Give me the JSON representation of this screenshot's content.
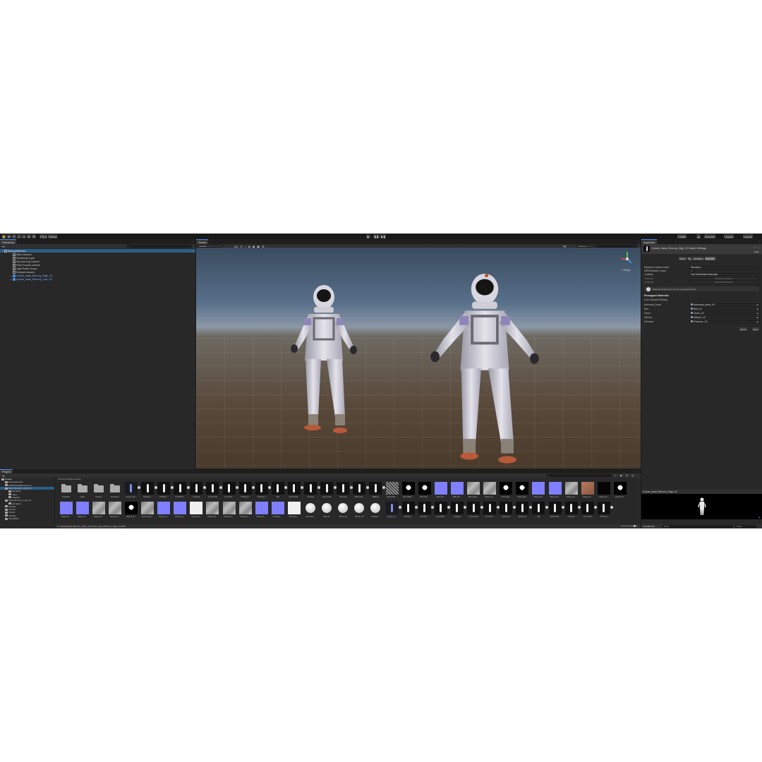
{
  "toolbar": {
    "pivot_label": "Pivot",
    "global_label": "Global",
    "layers_label": "Layers",
    "layout_label": "Layout",
    "account_label": "Account",
    "collab_label": "Collab"
  },
  "hierarchy": {
    "tab_label": "Hierarchy",
    "items": [
      {
        "label": "ExampleScene",
        "depth": 0,
        "kind": "scene"
      },
      {
        "label": "Main Camera",
        "depth": 1,
        "kind": "go"
      },
      {
        "label": "Directional Light",
        "depth": 1,
        "kind": "go"
      },
      {
        "label": "Sky and Fog Volume",
        "depth": 1,
        "kind": "go"
      },
      {
        "label": "Post Process Volume",
        "depth": 1,
        "kind": "go"
      },
      {
        "label": "Light Probe Group",
        "depth": 1,
        "kind": "go"
      },
      {
        "label": "Example Assets",
        "depth": 1,
        "kind": "go"
      },
      {
        "label": "A pose_nasa_Mercury_High_V2",
        "depth": 1,
        "kind": "prefab"
      },
      {
        "label": "A pose_nasa_Mercury_Low_V2",
        "depth": 1,
        "kind": "prefab"
      }
    ]
  },
  "scene": {
    "tab_label": "Scene",
    "shading_mode": "Shaded",
    "gizmos_label": "Gizmos",
    "persp_label": "< Persp"
  },
  "inspector": {
    "tab_label": "Inspector",
    "title": "A pose_nasa_Mercury_High_V2 Import Settings",
    "open_label": "Open",
    "tabs": [
      "Model",
      "Rig",
      "Animation",
      "Materials"
    ],
    "rows": [
      {
        "label": "Material Creation Mode",
        "value": "Standard"
      },
      {
        "label": "sRGB Albedo Colors",
        "value": "✓"
      },
      {
        "label": "Location",
        "value": "Use Embedded Materials"
      },
      {
        "label": "Textures",
        "value": "Extract Textures..."
      },
      {
        "label": "Materials",
        "value": "Extract Materials..."
      }
    ],
    "info_text": "Material assignments can be remapped below.",
    "remap_header": "Remapped Materials",
    "on_demand_label": "On Demand Remap",
    "remaps": [
      {
        "label": "Astronaut_head",
        "value": "Astronaut_head_V2"
      },
      {
        "label": "Bell",
        "value": "Bell_V2"
      },
      {
        "label": "Glove",
        "value": "Glove_V2"
      },
      {
        "label": "Helmet",
        "value": "Helmet_V2"
      },
      {
        "label": "Pressure",
        "value": "Pressure_V2"
      }
    ],
    "revert_label": "Revert",
    "apply_label": "Apply",
    "preview_title": "A pose_nasa_Mercury_High_V2",
    "assetbundle_label": "AssetBundle",
    "assetbundle_value": "None",
    "variant_value": "None"
  },
  "project": {
    "tab_label": "Project",
    "status_text": "Showing Multiple Assets...",
    "tree": [
      {
        "label": "Assets",
        "depth": 0
      },
      {
        "label": "ExampleAssets",
        "depth": 1
      },
      {
        "label": "HDRPDefaultResources",
        "depth": 1
      },
      {
        "label": "Nasa_Mercury_High_V2",
        "depth": 1
      },
      {
        "label": "animation",
        "depth": 2
      },
      {
        "label": "maps",
        "depth": 2
      },
      {
        "label": "material",
        "depth": 2
      },
      {
        "label": "Nasa_Mercury_Low_V2",
        "depth": 1
      },
      {
        "label": "animation",
        "depth": 2
      },
      {
        "label": "Prefabs",
        "depth": 1
      },
      {
        "label": "Scenes",
        "depth": 1
      },
      {
        "label": "Scripts",
        "depth": 1
      },
      {
        "label": "Settings",
        "depth": 1
      },
      {
        "label": "TutorialInfo",
        "depth": 1
      }
    ],
    "path": "Assets/Nasa_Mercury_High_V2/A pose_nasa_Mercury_High_V2.FBX",
    "row1": [
      {
        "label": "animation",
        "kind": "folder"
      },
      {
        "label": "maps",
        "kind": "folder"
      },
      {
        "label": "material",
        "kind": "folder"
      },
      {
        "label": "animation",
        "kind": "folder"
      },
      {
        "label": "A pose_nas...",
        "kind": "model"
      },
      {
        "label": "Climbing...",
        "kind": "anim"
      },
      {
        "label": "Climbing...",
        "kind": "anim"
      },
      {
        "label": "Crawl Bac...",
        "kind": "anim"
      },
      {
        "label": "Crawling",
        "kind": "anim"
      },
      {
        "label": "Crouch Idle",
        "kind": "anim"
      },
      {
        "label": "Crouched...",
        "kind": "anim"
      },
      {
        "label": "Floating_2",
        "kind": "anim"
      },
      {
        "label": "Floating_3",
        "kind": "anim"
      },
      {
        "label": "Idle",
        "kind": "anim"
      },
      {
        "label": "Injured Wa...",
        "kind": "anim"
      },
      {
        "label": "Jumping",
        "kind": "anim"
      },
      {
        "label": "Low Crawl",
        "kind": "anim"
      },
      {
        "label": "Running",
        "kind": "anim"
      },
      {
        "label": "Swimming...",
        "kind": "anim"
      },
      {
        "label": "Walking",
        "kind": "anim"
      },
      {
        "label": "Bell_Displ...",
        "kind": "noise"
      },
      {
        "label": "Bell_Mask...",
        "kind": "mask"
      },
      {
        "label": "Bell_Met...",
        "kind": "mask"
      },
      {
        "label": "Bell_Nor...",
        "kind": "normal"
      },
      {
        "label": "Bell_Nor...",
        "kind": "normal"
      },
      {
        "label": "Bell_Roug...",
        "kind": "gray"
      },
      {
        "label": "Glove_Ao...",
        "kind": "gray"
      },
      {
        "label": "Glove_Ba...",
        "kind": "mask"
      },
      {
        "label": "Glove_Me...",
        "kind": "mask"
      },
      {
        "label": "Glove_No...",
        "kind": "normal"
      },
      {
        "label": "Glove_No...",
        "kind": "normal"
      },
      {
        "label": "Glove_Ro...",
        "kind": "gray"
      },
      {
        "label": "Head_Ast...",
        "kind": "skin"
      },
      {
        "label": "Head_Ast...",
        "kind": "black"
      },
      {
        "label": "Head_Ast...",
        "kind": "mask"
      }
    ],
    "row2": [
      {
        "label": "Head_Ast...",
        "kind": "normal"
      },
      {
        "label": "Head_Ast...",
        "kind": "normal"
      },
      {
        "label": "Head_Ast...",
        "kind": "gray"
      },
      {
        "label": "Helmet_D...",
        "kind": "gray"
      },
      {
        "label": "Helmet_M...",
        "kind": "mask"
      },
      {
        "label": "Helmet_Me...",
        "kind": "gray"
      },
      {
        "label": "Helmet_N...",
        "kind": "normal"
      },
      {
        "label": "Helmet_N...",
        "kind": "normal"
      },
      {
        "label": "Helmet_R...",
        "kind": "white"
      },
      {
        "label": "Helmet_R...",
        "kind": "gray"
      },
      {
        "label": "Pressure_...",
        "kind": "gray"
      },
      {
        "label": "Pressure_...",
        "kind": "gray"
      },
      {
        "label": "Pressure_...",
        "kind": "normal"
      },
      {
        "label": "Pressure_...",
        "kind": "normal"
      },
      {
        "label": "Pressure_...",
        "kind": "white"
      },
      {
        "label": "Astronaut...",
        "kind": "sphere"
      },
      {
        "label": "Bell_V2",
        "kind": "sphere"
      },
      {
        "label": "Glove_V2",
        "kind": "sphere"
      },
      {
        "label": "Helmet_V2",
        "kind": "sphere"
      },
      {
        "label": "Pressure...",
        "kind": "sphere"
      },
      {
        "label": "A pose_na...",
        "kind": "model"
      },
      {
        "label": "Climbing...",
        "kind": "anim"
      },
      {
        "label": "Climbing...",
        "kind": "anim"
      },
      {
        "label": "Crawl Bac...",
        "kind": "anim"
      },
      {
        "label": "Crawling",
        "kind": "anim"
      },
      {
        "label": "Crouch Idle",
        "kind": "anim"
      },
      {
        "label": "Crouched...",
        "kind": "anim"
      },
      {
        "label": "Floating_2",
        "kind": "anim"
      },
      {
        "label": "Floating_3",
        "kind": "anim"
      },
      {
        "label": "Idle",
        "kind": "anim"
      },
      {
        "label": "Injured Wa...",
        "kind": "anim"
      },
      {
        "label": "Jumping",
        "kind": "anim"
      },
      {
        "label": "Low Crawl",
        "kind": "anim"
      },
      {
        "label": "Running",
        "kind": "anim"
      }
    ]
  },
  "colors": {
    "accent": "#4d8af0",
    "selection": "#2c5d87",
    "prefab_text": "#7ab4ff",
    "normal_map": "#7f7fff"
  }
}
